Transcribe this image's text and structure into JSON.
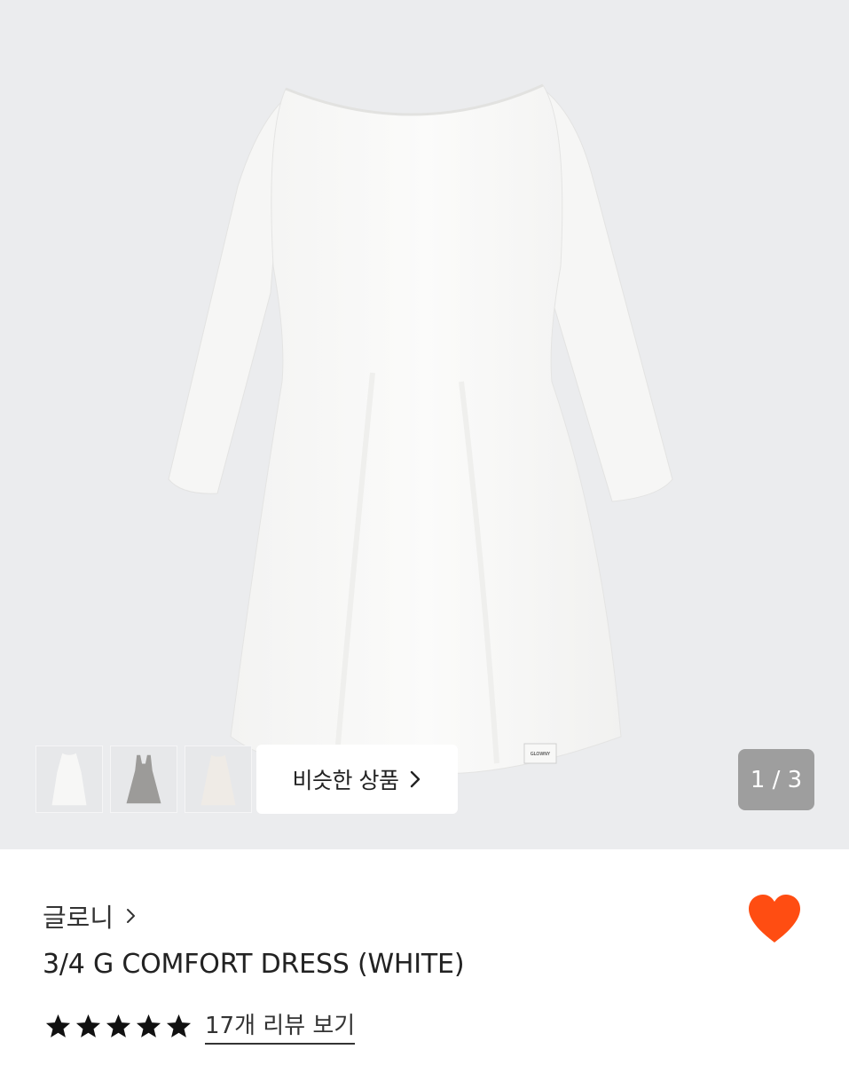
{
  "gallery": {
    "similar_label": "비슷한 상품",
    "counter": "1 / 3",
    "label_tag": "GLOWNY"
  },
  "product": {
    "brand": "글로니",
    "title": "3/4 G COMFORT DRESS (WHITE)",
    "rating_stars": 5,
    "review_label": "17개 리뷰 보기",
    "liked": true
  },
  "colors": {
    "background": "#ebecee",
    "heart": "#ff4d12",
    "counter_bg": "#9e9e9e"
  },
  "icons": [
    "chevron-right-icon",
    "heart-icon",
    "star-icon"
  ]
}
